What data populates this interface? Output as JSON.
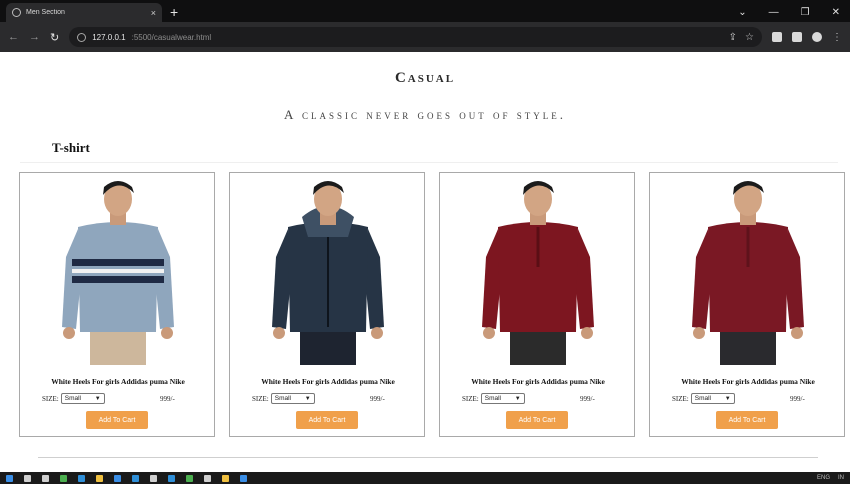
{
  "browser": {
    "tab_title": "Men Section",
    "tab_close": "×",
    "new_tab": "+",
    "window_controls": [
      "⌄",
      "—",
      "❐",
      "✕"
    ],
    "nav": {
      "back": "←",
      "forward": "→",
      "reload": "↻"
    },
    "url_host": "127.0.0.1",
    "url_path": ":5500/casualwear.html",
    "omnibox_icons": [
      "share-icon",
      "star-icon"
    ],
    "extension_icons": [
      "extensions-icon",
      "sidebar-icon",
      "profile-icon",
      "menu-icon"
    ]
  },
  "page": {
    "heading": "Casual",
    "tagline": "A classic never goes out of style.",
    "section_title": "T-shirt",
    "products": [
      {
        "name": "White Heels For girls Addidas puma Nike",
        "size_label": "SIZE:",
        "size_selected": "Small",
        "price": "999/-",
        "button": "Add To Cart",
        "shirt_color": "#8fa6bd",
        "stripe_color": "#1f2a44",
        "pants_color": "#cdb79c"
      },
      {
        "name": "White Heels For girls Addidas puma Nike",
        "size_label": "SIZE:",
        "size_selected": "Small",
        "price": "999/-",
        "button": "Add To Cart",
        "shirt_color": "#263445",
        "stripe_color": "#3e5064",
        "pants_color": "#1e2430"
      },
      {
        "name": "White Heels For girls Addidas puma Nike",
        "size_label": "SIZE:",
        "size_selected": "Small",
        "price": "999/-",
        "button": "Add To Cart",
        "shirt_color": "#7d1620",
        "stripe_color": "#5a0e15",
        "pants_color": "#2b2b2b"
      },
      {
        "name": "White Heels For girls Addidas puma Nike",
        "size_label": "SIZE:",
        "size_selected": "Small",
        "price": "999/-",
        "button": "Add To Cart",
        "shirt_color": "#7a1824",
        "stripe_color": "#5e121b",
        "pants_color": "#2a2a2e"
      }
    ]
  },
  "colors": {
    "button_bg": "#f0a04b",
    "card_border": "#a9a9a9",
    "taskbar_bg": "#1a1a1a"
  },
  "taskbar": {
    "icons": [
      "windows-start-icon",
      "search-icon",
      "task-view-icon",
      "chrome-icon",
      "edge-icon",
      "files-icon",
      "store-icon",
      "mail-icon",
      "settings-icon",
      "vscode-icon",
      "photos-icon",
      "terminal-icon",
      "folder-icon",
      "app-icon"
    ],
    "icon_colors": [
      "#3a8ee6",
      "#cfcfcf",
      "#cfcfcf",
      "#4caf50",
      "#2f8fd8",
      "#f0c040",
      "#3a8ee6",
      "#2f8fd8",
      "#cfcfcf",
      "#2f8fd8",
      "#4caf50",
      "#cfcfcf",
      "#f0c040",
      "#3a8ee6"
    ],
    "tray_lang": "ENG",
    "tray_region": "IN"
  }
}
